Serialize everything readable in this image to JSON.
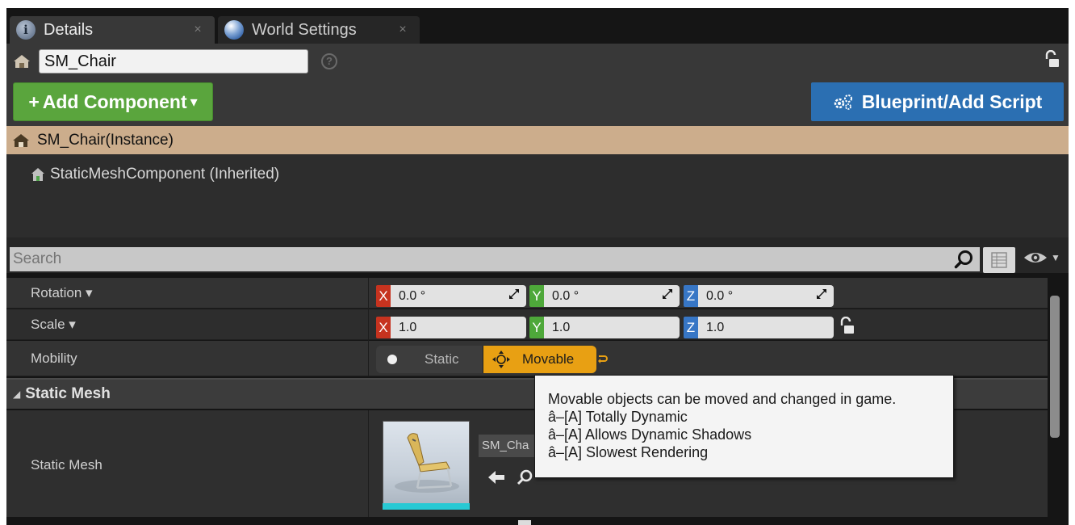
{
  "tabs": [
    {
      "label": "Details",
      "icon": "info-icon",
      "close": "×"
    },
    {
      "label": "World Settings",
      "icon": "globe-icon",
      "close": "×"
    }
  ],
  "actor": {
    "name": "SM_Chair",
    "help_glyph": "?"
  },
  "toolbar": {
    "add_component_label": "Add Component",
    "add_component_prefix": "+",
    "add_component_caret": "▾",
    "blueprint_label": "Blueprint/Add Script",
    "blueprint_icon": "gears-icon",
    "add_color": "#5aa53d",
    "blueprint_color": "#2b6fb2"
  },
  "components": {
    "instance": "SM_Chair(Instance)",
    "inherited": "StaticMeshComponent (Inherited)",
    "selected_color": "#ccad8c"
  },
  "search": {
    "placeholder": "Search"
  },
  "transform": {
    "rotation": {
      "label": "Rotation ▾",
      "x": "0.0 °",
      "y": "0.0 °",
      "z": "0.0 °"
    },
    "scale": {
      "label": "Scale ▾",
      "x": "1.0",
      "y": "1.0",
      "z": "1.0"
    },
    "axis_labels": {
      "x": "X",
      "y": "Y",
      "z": "Z"
    },
    "axis_colors": {
      "x": "#c6331f",
      "y": "#4ea83a",
      "z": "#3776c5"
    }
  },
  "mobility": {
    "label": "Mobility",
    "options": [
      "Static",
      "Movable"
    ],
    "selected": "Movable",
    "selected_color": "#e8a013"
  },
  "static_mesh": {
    "category": "Static Mesh",
    "label": "Static Mesh",
    "asset_name": "SM_Cha"
  },
  "tooltip": {
    "title": "Movable objects can be moved and changed in game.",
    "lines": [
      "â–[A] Totally Dynamic",
      "â–[A] Allows Dynamic Shadows",
      "â–[A] Slowest Rendering"
    ]
  }
}
